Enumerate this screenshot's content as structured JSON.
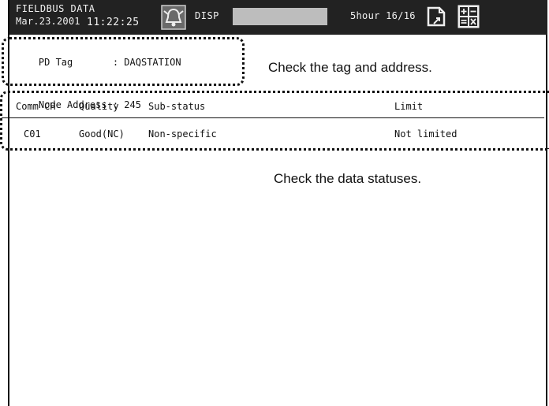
{
  "status_bar": {
    "title": "FIELDBUS DATA",
    "date": "Mar.23.2001",
    "time": "11:22:25",
    "disp_label": "DISP",
    "memory_text": "5hour 16/16",
    "icons": [
      "alarm-icon",
      "save-icon",
      "calculation-icon"
    ]
  },
  "tag_info": {
    "pd_tag_label": "PD Tag",
    "pd_tag_value": "DAQSTATION",
    "node_address_label": "Node Address",
    "node_address_value": "245"
  },
  "notes": {
    "tag_note": "Check the tag and address.",
    "status_note": "Check the data statuses."
  },
  "table": {
    "headers": [
      "Comm CH",
      "Quality",
      "Sub-status",
      "Limit"
    ],
    "rows": [
      [
        "C01",
        "Good(NC)",
        "Non-specific",
        "Not limited"
      ]
    ]
  },
  "colors": {
    "status_bar_bg": "#222222",
    "text": "#111111",
    "background": "#ffffff"
  }
}
